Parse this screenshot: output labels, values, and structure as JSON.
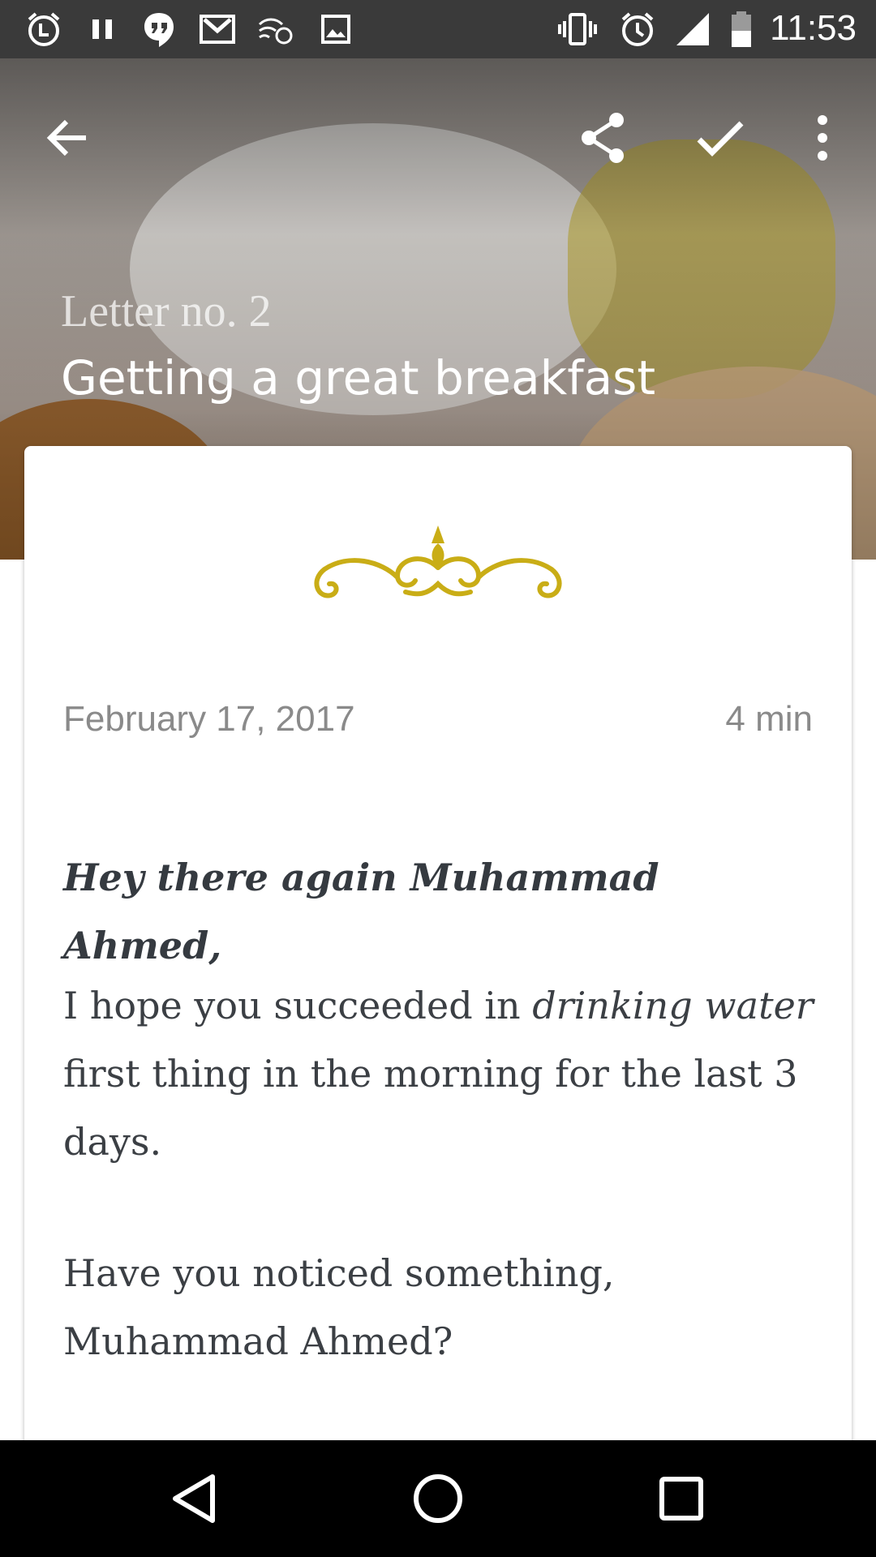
{
  "status_bar": {
    "time": "11:53",
    "left_icons": [
      "alarm-l-icon",
      "pause-icon",
      "hangouts-icon",
      "gmail-icon",
      "data-saver-icon",
      "image-icon"
    ],
    "right_icons": [
      "vibrate-icon",
      "alarm-icon",
      "signal-icon",
      "battery-icon"
    ]
  },
  "header": {
    "subtitle": "Letter no. 2",
    "title": "Getting a great breakfast",
    "actions": [
      "back-arrow-icon",
      "share-icon",
      "check-icon",
      "more-vert-icon"
    ]
  },
  "letter": {
    "date": "February 17, 2017",
    "read_time": "4 min",
    "greeting": "Hey there again Muhammad Ahmed,",
    "para1_before": "I hope you succeeded in ",
    "para1_emphasis": "drinking water",
    "para1_after": " first thing in the morning for the last 3 days.",
    "para2": "Have you noticed something, Muhammad Ahmed?"
  },
  "colors": {
    "ornament": "#c9ad16",
    "status_bar": "#3a3a3a",
    "nav_bar": "#000000",
    "body_text": "#3b3f44"
  },
  "nav_bar": [
    "back-triangle-icon",
    "home-circle-icon",
    "recents-square-icon"
  ]
}
